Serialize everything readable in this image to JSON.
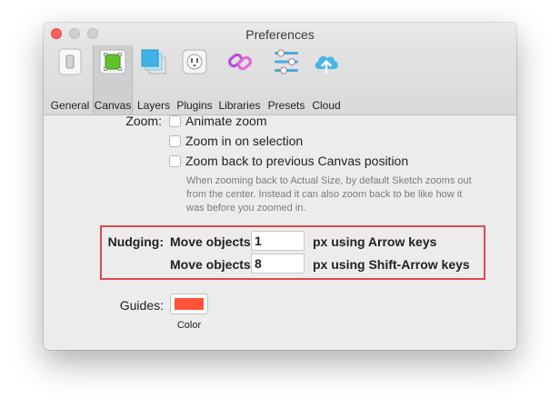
{
  "window": {
    "title": "Preferences"
  },
  "toolbar": {
    "items": [
      {
        "label": "General",
        "icon": "switch-icon"
      },
      {
        "label": "Canvas",
        "icon": "canvas-icon",
        "active": true
      },
      {
        "label": "Layers",
        "icon": "layers-icon"
      },
      {
        "label": "Plugins",
        "icon": "plug-icon"
      },
      {
        "label": "Libraries",
        "icon": "link-icon"
      },
      {
        "label": "Presets",
        "icon": "sliders-icon"
      },
      {
        "label": "Cloud",
        "icon": "cloud-upload-icon"
      }
    ]
  },
  "zoom": {
    "label": "Zoom:",
    "options": [
      {
        "label": "Animate zoom",
        "checked": false
      },
      {
        "label": "Zoom in on selection",
        "checked": false
      },
      {
        "label": "Zoom back to previous Canvas position",
        "checked": false
      }
    ],
    "hint": "When zooming back to Actual Size, by default Sketch zooms out from the center. Instead it can also zoom back to be like how it was before you zoomed in."
  },
  "nudging": {
    "label": "Nudging:",
    "rows": [
      {
        "prefix": "Move objects",
        "value": "1",
        "suffix": "px using Arrow keys"
      },
      {
        "prefix": "Move objects",
        "value": "8",
        "suffix": "px using Shift-Arrow keys"
      }
    ],
    "highlight_color": "#e0484d"
  },
  "guides": {
    "label": "Guides:",
    "color": "#fe5438",
    "color_label": "Color"
  }
}
